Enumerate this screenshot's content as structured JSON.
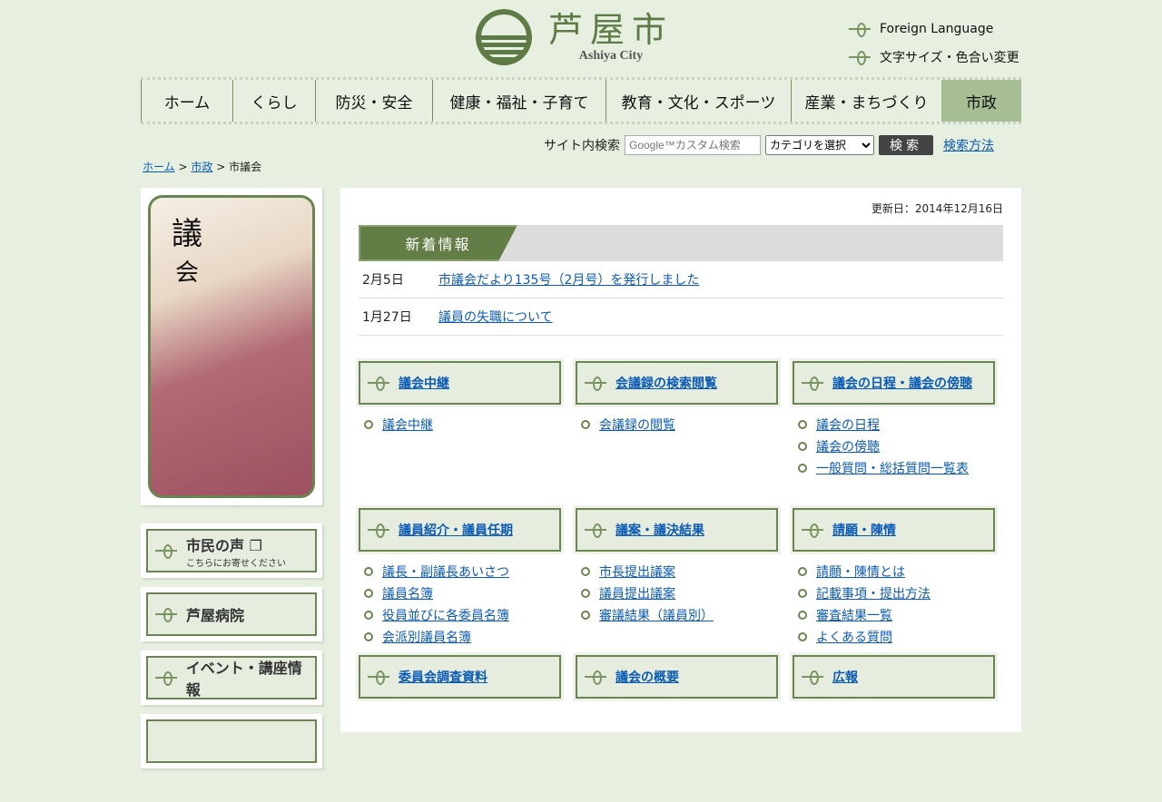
{
  "header": {
    "logo_jp": "芦屋市",
    "logo_en": "Ashiya City",
    "util": [
      "Foreign Language",
      "文字サイズ・色合い変更"
    ]
  },
  "nav": [
    "ホーム",
    "くらし",
    "防災・安全",
    "健康・福祉・子育て",
    "教育・文化・スポーツ",
    "産業・まちづくり",
    "市政"
  ],
  "search": {
    "label": "サイト内検索",
    "placeholder": "Google™カスタム検索",
    "category": "カテゴリを選択",
    "button": "検索",
    "help": "検索方法"
  },
  "breadcrumb": {
    "home": "ホーム",
    "parent": "市政",
    "current": "市議会",
    "sep": ">"
  },
  "sidebar": {
    "photo_title1": "議",
    "photo_title2": "会",
    "banners": [
      {
        "label": "市民の声",
        "sub": "こちらにお寄せください"
      },
      {
        "label": "芦屋病院"
      },
      {
        "label": "イベント・講座情報"
      }
    ]
  },
  "main": {
    "updated": "更新日：2014年12月16日",
    "news_title": "新着情報",
    "news": [
      {
        "date": "2月5日",
        "title": "市議会だより135号（2月号）を発行しました"
      },
      {
        "date": "1月27日",
        "title": "議員の失職について"
      }
    ],
    "categories": [
      {
        "title": "議会中継",
        "links": [
          "議会中継"
        ]
      },
      {
        "title": "会議録の検索閲覧",
        "links": [
          "会議録の閲覧"
        ]
      },
      {
        "title": "議会の日程・議会の傍聴",
        "links": [
          "議会の日程",
          "議会の傍聴",
          "一般質問・総括質問一覧表"
        ]
      },
      {
        "title": "議員紹介・議員任期",
        "links": [
          "議長・副議長あいさつ",
          "議員名簿",
          "役員並びに各委員名簿",
          "会派別議員名簿"
        ]
      },
      {
        "title": "議案・議決結果",
        "links": [
          "市長提出議案",
          "議員提出議案",
          "審議結果（議員別）"
        ]
      },
      {
        "title": "請願・陳情",
        "links": [
          "請願・陳情とは",
          "記載事項・提出方法",
          "審査結果一覧",
          "よくある質問"
        ]
      },
      {
        "title": "委員会調査資料",
        "links": []
      },
      {
        "title": "議会の概要",
        "links": []
      },
      {
        "title": "広報",
        "links": []
      }
    ]
  },
  "colors": {
    "bg": "#e7efe0",
    "accent": "#627d46",
    "link": "#0a5bb5"
  }
}
